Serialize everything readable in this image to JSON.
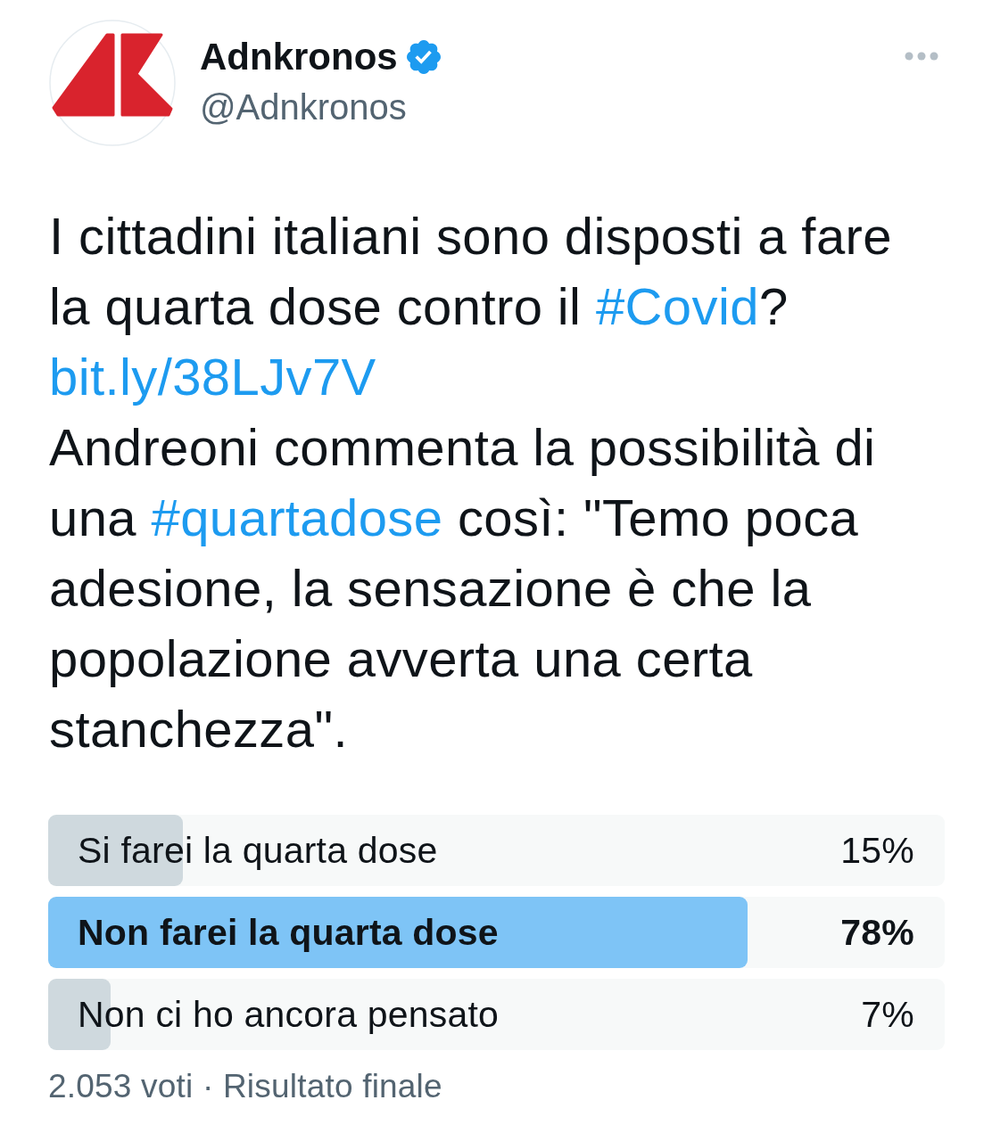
{
  "author": {
    "name": "Adnkronos",
    "verified": true,
    "handle": "@Adnkronos"
  },
  "tweet": {
    "segments": [
      {
        "kind": "text",
        "text": "I cittadini italiani sono disposti a fare la quarta dose contro il "
      },
      {
        "kind": "hashtag",
        "text": "#Covid"
      },
      {
        "kind": "text",
        "text": "? "
      },
      {
        "kind": "link",
        "text": "bit.ly/38LJv7V"
      },
      {
        "kind": "text",
        "text": "\nAndreoni commenta la possibilità di una "
      },
      {
        "kind": "hashtag",
        "text": "#quartadose"
      },
      {
        "kind": "text",
        "text": " così: \"Temo poca adesione, la sensazione è che la popolazione avverta una certa stanchezza\"."
      }
    ]
  },
  "poll": {
    "options": [
      {
        "label": "Si farei la quarta dose",
        "percent": "15%",
        "level": 0.15,
        "winner": false
      },
      {
        "label": "Non farei la quarta dose",
        "percent": "78%",
        "level": 0.78,
        "winner": true
      },
      {
        "label": "Non ci ho ancora pensato",
        "percent": "7%",
        "level": 0.07,
        "winner": false
      }
    ],
    "footer": "2.053 voti · Risultato finale"
  }
}
